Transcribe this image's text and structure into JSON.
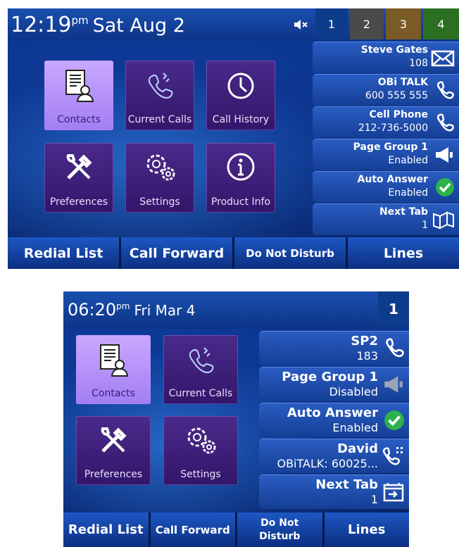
{
  "screen1": {
    "time": "12:19",
    "ampm": "pm",
    "date": "Sat Aug 2",
    "tabs": [
      "1",
      "2",
      "3",
      "4"
    ],
    "apps": [
      {
        "label": "Contacts",
        "icon": "contacts-icon"
      },
      {
        "label": "Current Calls",
        "icon": "phone-icon"
      },
      {
        "label": "Call History",
        "icon": "history-icon"
      },
      {
        "label": "Preferences",
        "icon": "tools-icon"
      },
      {
        "label": "Settings",
        "icon": "gears-icon"
      },
      {
        "label": "Product Info",
        "icon": "info-icon"
      }
    ],
    "line_keys": [
      {
        "title": "Steve Gates",
        "sub": "108",
        "icon": "envelope-icon"
      },
      {
        "title": "OBi TALK",
        "sub": "600 555 555",
        "icon": "phone-icon"
      },
      {
        "title": "Cell Phone",
        "sub": "212-736-5000",
        "icon": "phone-icon"
      },
      {
        "title": "Page Group 1",
        "sub": "Enabled",
        "icon": "megaphone-icon"
      },
      {
        "title": "Auto Answer",
        "sub": "Enabled",
        "icon": "check-icon"
      },
      {
        "title": "Next Tab",
        "sub": "1",
        "icon": "book-icon"
      }
    ],
    "softkeys": [
      "Redial List",
      "Call Forward",
      "Do Not Disturb",
      "Lines"
    ]
  },
  "screen2": {
    "time": "06:20",
    "ampm": "pm",
    "date": "Fri Mar 4",
    "tab": "1",
    "apps": [
      {
        "label": "Contacts",
        "icon": "contacts-icon"
      },
      {
        "label": "Current Calls",
        "icon": "phone-icon"
      },
      {
        "label": "Preferences",
        "icon": "tools-icon"
      },
      {
        "label": "Settings",
        "icon": "gears-icon"
      }
    ],
    "line_keys": [
      {
        "title": "SP2",
        "sub": "183",
        "icon": "phone-icon"
      },
      {
        "title": "Page Group 1",
        "sub": "Disabled",
        "icon": "megaphone-icon"
      },
      {
        "title": "Auto Answer",
        "sub": "Enabled",
        "icon": "check-icon"
      },
      {
        "title": "David",
        "sub": "OBiTALK: 60025...",
        "icon": "phone-dialpad-icon"
      },
      {
        "title": "Next Tab",
        "sub": "1",
        "icon": "next-tab-icon"
      }
    ],
    "softkeys": [
      "Redial List",
      "Call Forward",
      "Do Not\nDisturb",
      "Lines"
    ]
  }
}
